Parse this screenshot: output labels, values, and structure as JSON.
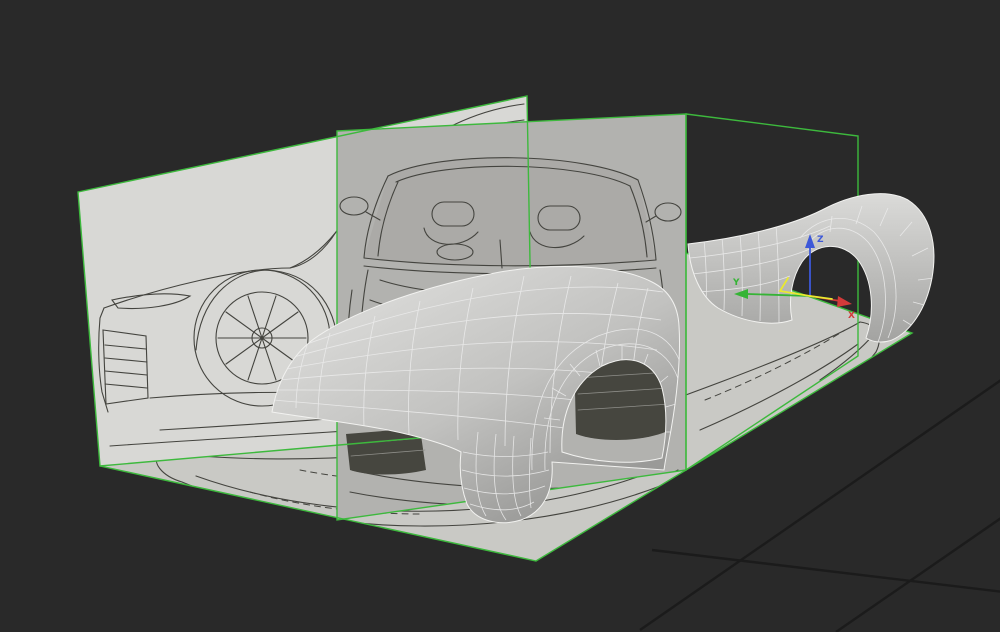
{
  "viewport": {
    "background_color": "#292929",
    "grid_line_color": "#1b1b1b"
  },
  "planes": {
    "edge_color": "#3db93d",
    "side": {
      "fill": "#d8d8d5"
    },
    "front": {
      "fill": "#b2b2af"
    },
    "floor": {
      "fill": "#c9c9c5"
    },
    "windshield_fill": "#abaaa7",
    "blueprint_line_color": "#44443f",
    "blueprint_dark_fill": "#46463f",
    "blueprint_slat_color": "#8f8f8a"
  },
  "mesh": {
    "surface_light": "#dcdcda",
    "surface_mid": "#c2c2c0",
    "surface_dark": "#9a9a98",
    "panel_light": "#dcdcda",
    "panel_dark": "#a0a09e",
    "outline_color": "#f2f2f0",
    "wire_color": "#ececec"
  },
  "gizmo": {
    "x": {
      "label": "X",
      "color": "#d23a3a"
    },
    "y": {
      "label": "Y",
      "color": "#35b435"
    },
    "z": {
      "label": "Z",
      "color": "#3d58d8"
    },
    "highlight": "#e9e92f"
  }
}
